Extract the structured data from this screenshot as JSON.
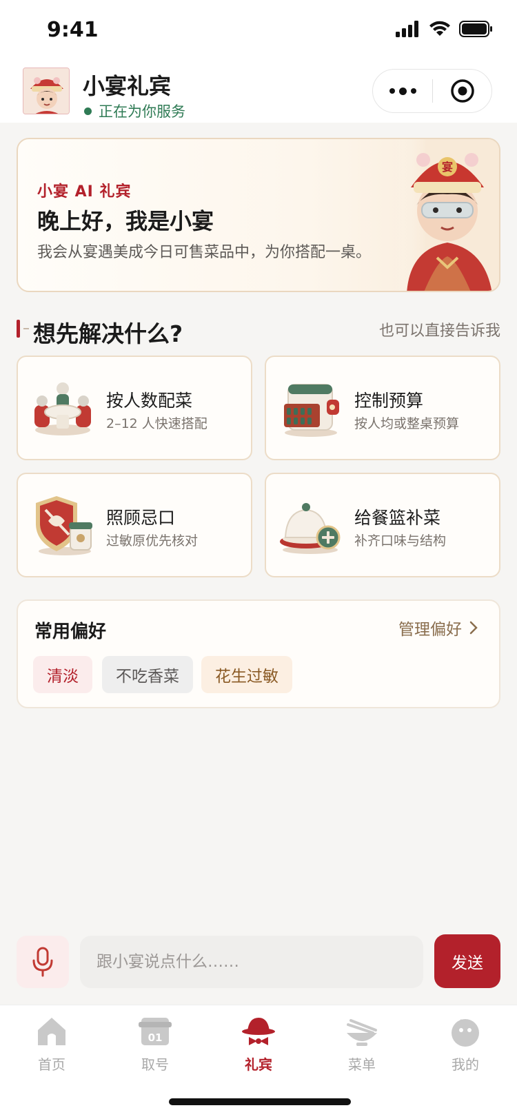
{
  "status_bar": {
    "time": "9:41"
  },
  "header": {
    "title": "小宴礼宾",
    "status": "正在为你服务"
  },
  "hero": {
    "tag": "小宴 AI 礼宾",
    "title": "晚上好，我是小宴",
    "description": "我会从宴遇美成今日可售菜品中，为你搭配一桌。",
    "badge_char": "宴"
  },
  "section": {
    "title": "想先解决什么?",
    "link": "也可以直接告诉我"
  },
  "cards": [
    {
      "title": "按人数配菜",
      "subtitle": "2–12 人快速搭配",
      "icon": "dining-table-icon"
    },
    {
      "title": "控制预算",
      "subtitle": "按人均或整桌预算",
      "icon": "wallet-abacus-icon"
    },
    {
      "title": "照顾忌口",
      "subtitle": "过敏原优先核对",
      "icon": "shield-allergy-icon"
    },
    {
      "title": "给餐篮补菜",
      "subtitle": "补齐口味与结构",
      "icon": "cloche-add-icon"
    }
  ],
  "preferences": {
    "title": "常用偏好",
    "manage_label": "管理偏好",
    "tags": [
      "清淡",
      "不吃香菜",
      "花生过敏"
    ]
  },
  "input": {
    "placeholder": "跟小宴说点什么……",
    "send_label": "发送"
  },
  "tabbar": {
    "items": [
      {
        "label": "首页",
        "icon": "home-icon",
        "active": false
      },
      {
        "label": "取号",
        "icon": "ticket-icon",
        "active": false,
        "icon_text": "01"
      },
      {
        "label": "礼宾",
        "icon": "concierge-hat-icon",
        "active": true
      },
      {
        "label": "菜单",
        "icon": "bowl-icon",
        "active": false
      },
      {
        "label": "我的",
        "icon": "profile-icon",
        "active": false
      }
    ]
  },
  "colors": {
    "brand_red": "#b3212b",
    "online_green": "#2f7b55",
    "card_border": "#ecdcc7"
  }
}
